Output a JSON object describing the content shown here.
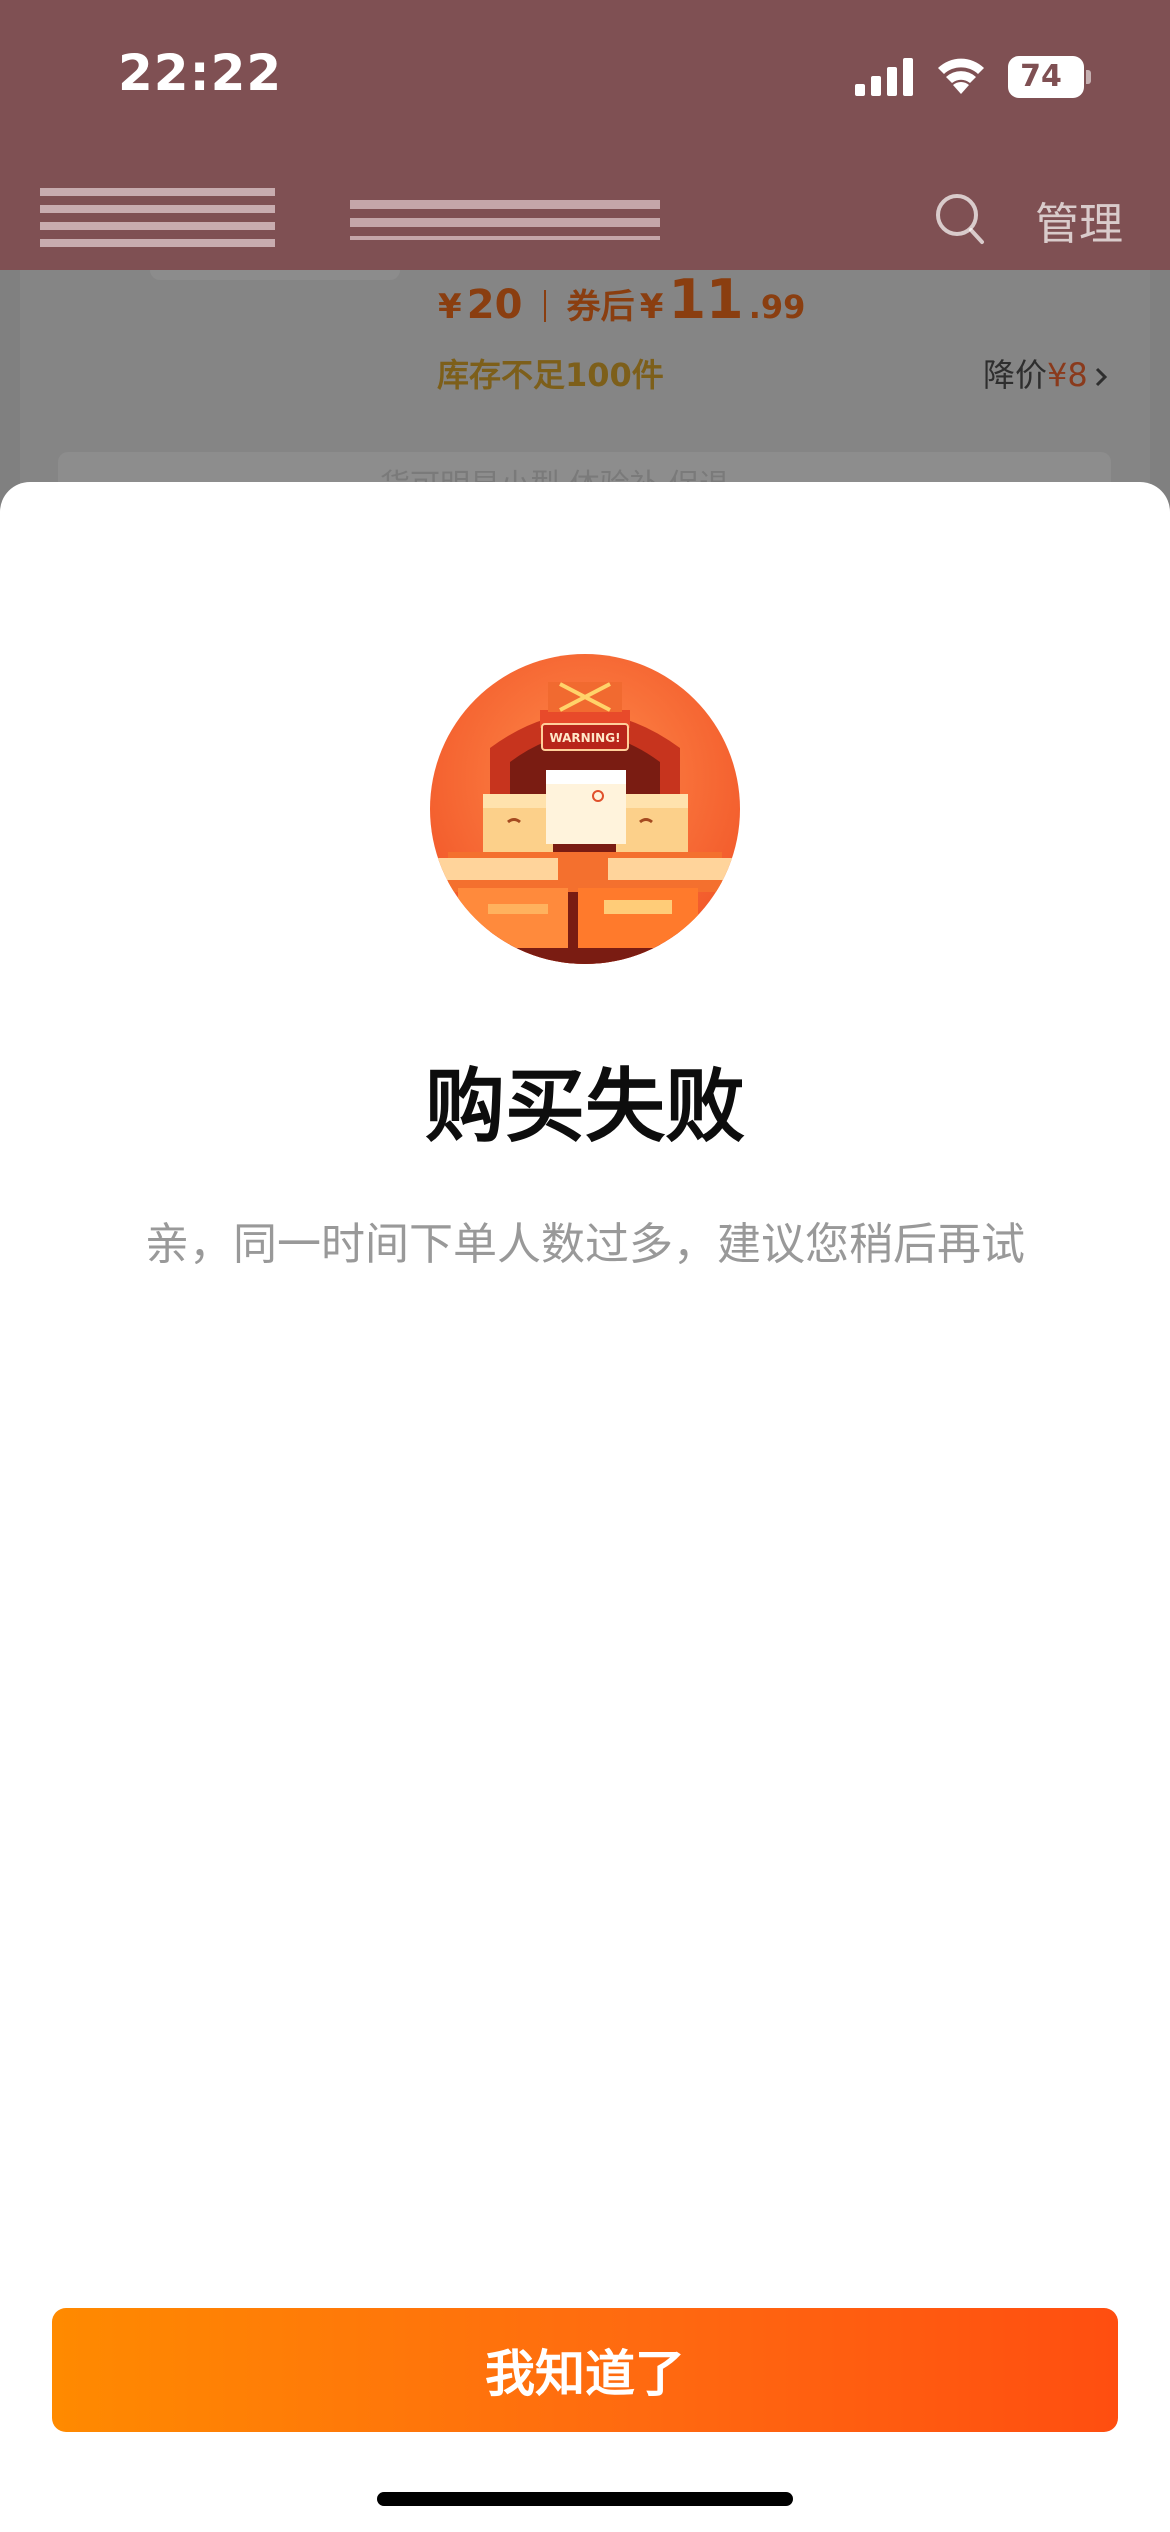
{
  "status_bar": {
    "time": "22:22",
    "battery": "74"
  },
  "nav": {
    "manage_label": "管理"
  },
  "product": {
    "currency": "¥",
    "price": "20",
    "coupon_label": "券后",
    "coupon_price_main": "11",
    "coupon_price_cents": ".99",
    "stock_text": "库存不足100件",
    "price_drop_label": "降价",
    "price_drop_value": "¥8",
    "info_strip_text": "货可明显小型 体验补 促退"
  },
  "dialog": {
    "illustration_label": "WARNING!",
    "title": "购买失败",
    "message": "亲，同一时间下单人数过多，建议您稍后再试",
    "button_label": "我知道了"
  },
  "colors": {
    "status_bar_bg": "#7f5053",
    "accent_start": "#ff8a00",
    "accent_end": "#ff4e10",
    "sheet_bg": "#ffffff",
    "title_text": "#0d0d0d",
    "message_text": "#999999"
  },
  "icons": {
    "signal": "signal-bars-icon",
    "wifi": "wifi-icon",
    "battery": "battery-icon",
    "search": "search-icon",
    "chevron": "chevron-right-icon",
    "illustration": "warning-boxes-icon"
  }
}
